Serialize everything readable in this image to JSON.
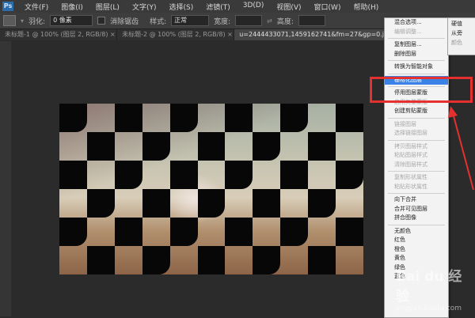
{
  "app": {
    "logo": "Ps",
    "menus": [
      "文件(F)",
      "图像(I)",
      "图层(L)",
      "文字(Y)",
      "选择(S)",
      "滤镜(T)",
      "3D(D)",
      "视图(V)",
      "窗口(W)",
      "帮助(H)"
    ]
  },
  "options_bar": {
    "feather_label": "羽化:",
    "feather_value": "0 像素",
    "antialias_label": "消除锯齿",
    "style_label": "样式:",
    "style_value": "正常",
    "width_label": "宽度:",
    "height_label": "高度:"
  },
  "tabs": [
    {
      "label": "未标题-1 @ 100% (图层 2, RGB/8) ×",
      "active": false
    },
    {
      "label": "未标题-2 @ 100% (图层 2, RGB/8) ×",
      "active": false
    },
    {
      "label": "u=2444433071,1459162741&fm=27&gp=0.jpg @ 120% (图层 1, RGB/8) ×",
      "active": true
    }
  ],
  "context_menu": {
    "groups": [
      [
        {
          "label": "混合选项...",
          "enabled": true
        },
        {
          "label": "编辑调整...",
          "enabled": false
        }
      ],
      [
        {
          "label": "复制图层...",
          "enabled": true
        },
        {
          "label": "删除图层",
          "enabled": true
        }
      ],
      [
        {
          "label": "转换为智能对象",
          "enabled": true
        }
      ],
      [
        {
          "label": "栅格化图层",
          "enabled": true,
          "highlighted": true
        }
      ],
      [
        {
          "label": "停用图层蒙版",
          "enabled": true
        },
        {
          "label": "启用矢量蒙版",
          "enabled": false
        },
        {
          "label": "创建剪贴蒙版",
          "enabled": true
        }
      ],
      [
        {
          "label": "链接图层",
          "enabled": false
        },
        {
          "label": "选择链接图层",
          "enabled": false
        }
      ],
      [
        {
          "label": "拷贝图层样式",
          "enabled": false
        },
        {
          "label": "粘贴图层样式",
          "enabled": false
        },
        {
          "label": "清除图层样式",
          "enabled": false
        }
      ],
      [
        {
          "label": "复制形状属性",
          "enabled": false
        },
        {
          "label": "粘贴形状属性",
          "enabled": false
        }
      ],
      [
        {
          "label": "向下合并",
          "enabled": true
        },
        {
          "label": "合并可见图层",
          "enabled": true
        },
        {
          "label": "拼合图像",
          "enabled": true
        }
      ],
      [
        {
          "label": "无颜色",
          "enabled": true
        },
        {
          "label": "红色",
          "enabled": true
        },
        {
          "label": "橙色",
          "enabled": true
        },
        {
          "label": "黄色",
          "enabled": true
        },
        {
          "label": "绿色",
          "enabled": true
        },
        {
          "label": "蓝色",
          "enabled": true
        }
      ]
    ]
  },
  "side_panel": {
    "items": [
      {
        "label": "硬值",
        "enabled": true
      },
      {
        "label": "从旁",
        "enabled": true
      },
      {
        "label": "颜色",
        "enabled": false
      }
    ]
  },
  "watermark": {
    "line1": "Bai du 经验",
    "line2": "jingyan.baidu.com"
  },
  "colors": {
    "highlight_box": "#e53030",
    "menu_selected": "#3c82e6",
    "canvas_dark": "#070707"
  }
}
